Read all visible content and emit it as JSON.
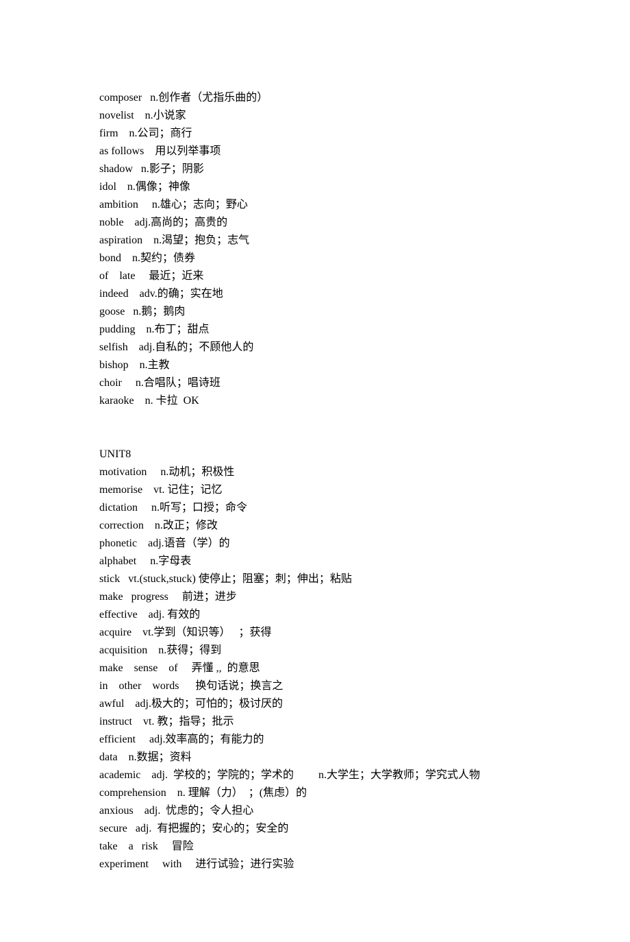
{
  "section1": [
    "composer   n.创作者（尤指乐曲的）",
    "novelist    n.小说家",
    "firm    n.公司；商行",
    "as follows    用以列举事项",
    "shadow   n.影子；阴影",
    "idol    n.偶像；神像",
    "ambition     n.雄心；志向；野心",
    "noble    adj.高尚的；高贵的",
    "aspiration    n.渴望；抱负；志气",
    "bond    n.契约；债券",
    "of    late     最近；近来",
    "indeed    adv.的确；实在地",
    "goose   n.鹅；鹅肉",
    "pudding    n.布丁；甜点",
    "selfish    adj.自私的；不顾他人的",
    "bishop    n.主教",
    "choir     n.合唱队；唱诗班",
    "karaoke    n. 卡拉  OK"
  ],
  "unit_label": "UNIT8",
  "section2": [
    "motivation     n.动机；积极性",
    "memorise    vt. 记住；记忆",
    "dictation     n.听写；口授；命令",
    "correction    n.改正；修改",
    "phonetic    adj.语音（学）的",
    "alphabet     n.字母表",
    "stick   vt.(stuck,stuck) 使停止；阻塞；刺；伸出；粘贴",
    "make   progress     前进；进步",
    "effective    adj. 有效的",
    "acquire    vt.学到（知识等）   ；获得",
    "acquisition    n.获得；得到",
    "make    sense    of     弄懂 ,,  的意思",
    "in    other    words      换句话说；换言之",
    "awful    adj.极大的；可怕的；极讨厌的",
    "instruct    vt. 教；指导；批示",
    "efficient     adj.效率高的；有能力的",
    "data    n.数据；资料",
    "academic    adj.  学校的；学院的；学术的         n.大学生；大学教师；学究式人物",
    "comprehension    n. 理解（力）  ；(焦虑）的",
    "anxious    adj.  忧虑的；令人担心",
    "secure   adj.  有把握的；安心的；安全的",
    "take    a   risk     冒险",
    "experiment     with     进行试验；进行实验"
  ]
}
